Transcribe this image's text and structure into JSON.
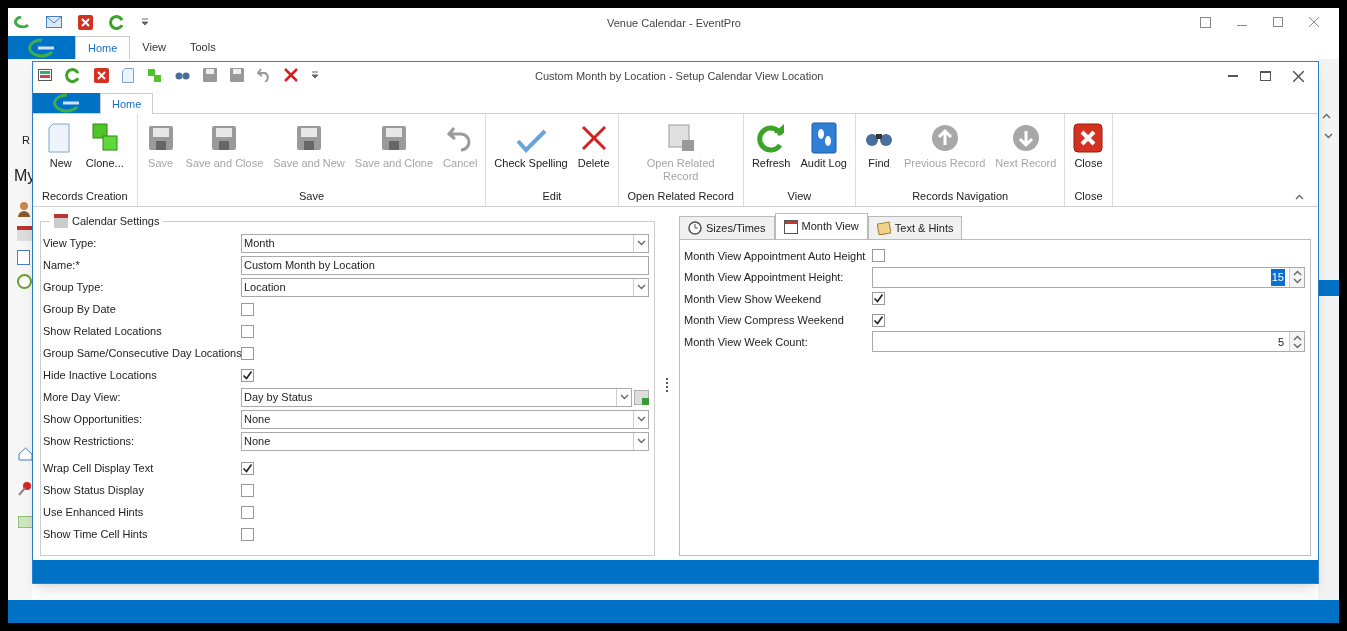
{
  "app_window": {
    "title": "Venue Calendar - EventPro",
    "tabs": [
      {
        "label": "Home",
        "selected": true
      },
      {
        "label": "View",
        "selected": false
      },
      {
        "label": "Tools",
        "selected": false
      }
    ],
    "partial_texts": [
      "R",
      "My"
    ]
  },
  "dialog": {
    "title": "Custom Month by Location - Setup Calendar View Location",
    "tabs": [
      {
        "label": "Home",
        "selected": true
      }
    ],
    "ribbon_groups": [
      {
        "label": "Records Creation",
        "buttons": [
          {
            "label": "New",
            "disabled": false
          },
          {
            "label": "Clone...",
            "disabled": false
          }
        ]
      },
      {
        "label": "Save",
        "buttons": [
          {
            "label": "Save",
            "disabled": true
          },
          {
            "label": "Save and Close",
            "disabled": true
          },
          {
            "label": "Save and New",
            "disabled": true
          },
          {
            "label": "Save and Clone",
            "disabled": true
          },
          {
            "label": "Cancel",
            "disabled": true
          }
        ]
      },
      {
        "label": "Edit",
        "buttons": [
          {
            "label": "Check Spelling",
            "disabled": false
          },
          {
            "label": "Delete",
            "disabled": false
          }
        ]
      },
      {
        "label": "Open Related Record",
        "buttons": [
          {
            "label": "Open Related Record",
            "disabled": true
          }
        ]
      },
      {
        "label": "View",
        "buttons": [
          {
            "label": "Refresh",
            "disabled": false
          },
          {
            "label": "Audit Log",
            "disabled": false
          }
        ]
      },
      {
        "label": "Records Navigation",
        "buttons": [
          {
            "label": "Find",
            "disabled": false
          },
          {
            "label": "Previous Record",
            "disabled": true
          },
          {
            "label": "Next Record",
            "disabled": true
          }
        ]
      },
      {
        "label": "Close",
        "buttons": [
          {
            "label": "Close",
            "disabled": false
          }
        ]
      }
    ],
    "calendar_settings": {
      "title": "Calendar Settings",
      "fields": [
        {
          "label": "View Type:",
          "kind": "dropdown",
          "value": "Month"
        },
        {
          "label": "Name:*",
          "kind": "text",
          "value": "Custom Month by Location"
        },
        {
          "label": "Group Type:",
          "kind": "dropdown",
          "value": "Location"
        },
        {
          "label": "Group By Date",
          "kind": "checkbox",
          "checked": false
        },
        {
          "label": "Show Related Locations",
          "kind": "checkbox",
          "checked": false
        },
        {
          "label": "Group Same/Consecutive Day Locations",
          "kind": "checkbox",
          "checked": false
        },
        {
          "label": "Hide Inactive Locations",
          "kind": "checkbox",
          "checked": true
        },
        {
          "label": "More Day View:",
          "kind": "dropdown_button",
          "value": "Day by Status"
        },
        {
          "label": "Show Opportunities:",
          "kind": "dropdown",
          "value": "None"
        },
        {
          "label": "Show Restrictions:",
          "kind": "dropdown",
          "value": "None"
        },
        {
          "label": "Wrap Cell Display Text",
          "kind": "checkbox",
          "checked": true
        },
        {
          "label": "Show Status Display",
          "kind": "checkbox",
          "checked": false
        },
        {
          "label": "Use Enhanced Hints",
          "kind": "checkbox",
          "checked": false
        },
        {
          "label": "Show Time Cell Hints",
          "kind": "checkbox",
          "checked": false
        }
      ]
    },
    "view_tabs": [
      {
        "label": "Sizes/Times",
        "selected": false
      },
      {
        "label": "Month View",
        "selected": true
      },
      {
        "label": "Text & Hints",
        "selected": false
      }
    ],
    "month_view_fields": [
      {
        "label": "Month View Appointment Auto Height",
        "kind": "checkbox",
        "checked": false
      },
      {
        "label": "Month View Appointment Height:",
        "kind": "spin",
        "value": "15",
        "highlighted": true
      },
      {
        "label": "Month View Show Weekend",
        "kind": "checkbox",
        "checked": true
      },
      {
        "label": "Month View Compress Weekend",
        "kind": "checkbox",
        "checked": true
      },
      {
        "label": "Month View Week Count:",
        "kind": "spin",
        "value": "5",
        "highlighted": false
      }
    ]
  }
}
